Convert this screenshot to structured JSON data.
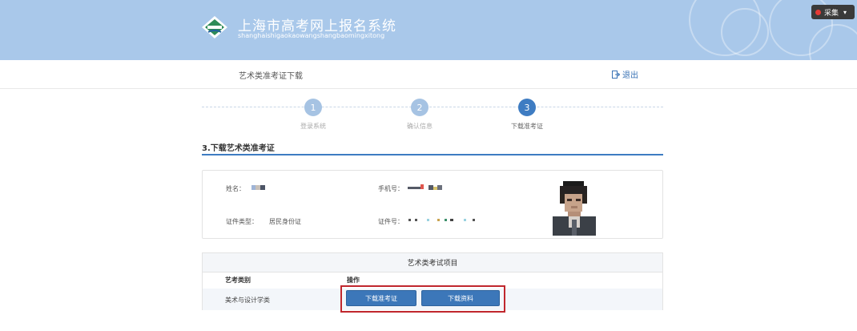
{
  "header": {
    "title": "上海市高考网上报名系统",
    "subtitle": "shanghaishigaokaowangshangbaomingxitong",
    "collect_label": "采集",
    "collect_caret": "▾"
  },
  "subbar": {
    "page_name": "艺术类准考证下载",
    "logout_label": "退出"
  },
  "steps": [
    {
      "number": "1",
      "label": "登录系统",
      "state": "done"
    },
    {
      "number": "2",
      "label": "确认信息",
      "state": "done"
    },
    {
      "number": "3",
      "label": "下载准考证",
      "state": "active"
    }
  ],
  "section": {
    "title": "3.下载艺术类准考证"
  },
  "info": {
    "name_label": "姓名：",
    "phone_label": "手机号：",
    "id_type_label": "证件类型：",
    "id_type_value": "居民身份证",
    "id_no_label": "证件号："
  },
  "items": {
    "title": "艺术类考试项目",
    "columns": [
      "艺考类别",
      "操作"
    ],
    "rows": [
      {
        "category": "美术与设计学类"
      }
    ],
    "buttons": {
      "download_ticket": "下载准考证",
      "download_material": "下载资料"
    }
  },
  "colors": {
    "header_bg": "#a9c8ea",
    "accent": "#3e7cc2",
    "highlight_border": "#c0272d"
  }
}
